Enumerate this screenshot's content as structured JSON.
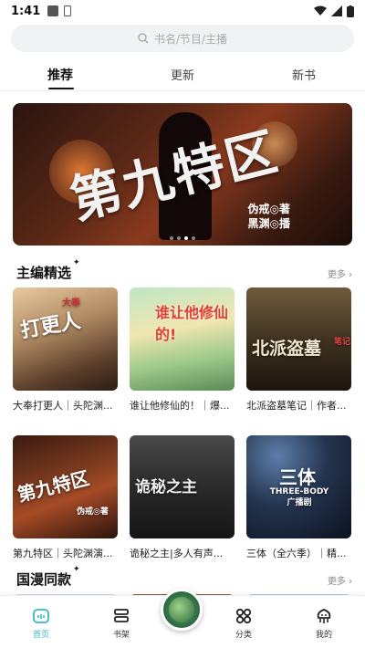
{
  "status_bar": {
    "time": "1:41"
  },
  "search": {
    "placeholder": "书名/节目/主播"
  },
  "tabs": [
    {
      "label": "推荐",
      "active": true
    },
    {
      "label": "更新",
      "active": false
    },
    {
      "label": "新书",
      "active": false
    }
  ],
  "banner": {
    "title": "第九特区",
    "author_line1": "伪戒◎著",
    "author_line2": "黑渊◎播",
    "slide_index": 2,
    "slide_count": 4
  },
  "sections": {
    "editors_pick": {
      "title": "主编精选",
      "more": "更多"
    },
    "guoman": {
      "title": "国漫同款",
      "more": "更多"
    }
  },
  "cards": [
    {
      "caption": "大奉打更人｜头陀渊...",
      "cover_text": "打更人",
      "cover_sub": "大奉"
    },
    {
      "caption": "谁让他修仙的！｜爆...",
      "cover_text": "谁让他修仙的!",
      "cover_sub": ""
    },
    {
      "caption": "北派盗墓笔记｜作者...",
      "cover_text": "北派盗墓",
      "cover_sub": "笔记"
    },
    {
      "caption": "第九特区｜头陀渊演...",
      "cover_text": "第九特区",
      "cover_sub": "伪戒◎著"
    },
    {
      "caption": "诡秘之主|多人有声...",
      "cover_text": "诡秘之主",
      "cover_sub": ""
    },
    {
      "caption": "三体（全六季）｜精...",
      "cover_text": "三体",
      "cover_sub": "THREE-BODY 广播剧"
    }
  ],
  "bottom_nav": [
    {
      "label": "首页",
      "icon": "home-icon",
      "active": true
    },
    {
      "label": "书架",
      "icon": "bookshelf-icon",
      "active": false
    },
    {
      "label": "分类",
      "icon": "category-icon",
      "active": false
    },
    {
      "label": "我的",
      "icon": "profile-icon",
      "active": false
    }
  ],
  "colors": {
    "accent": "#38b6c9",
    "highlight": "#c4f0e8"
  }
}
